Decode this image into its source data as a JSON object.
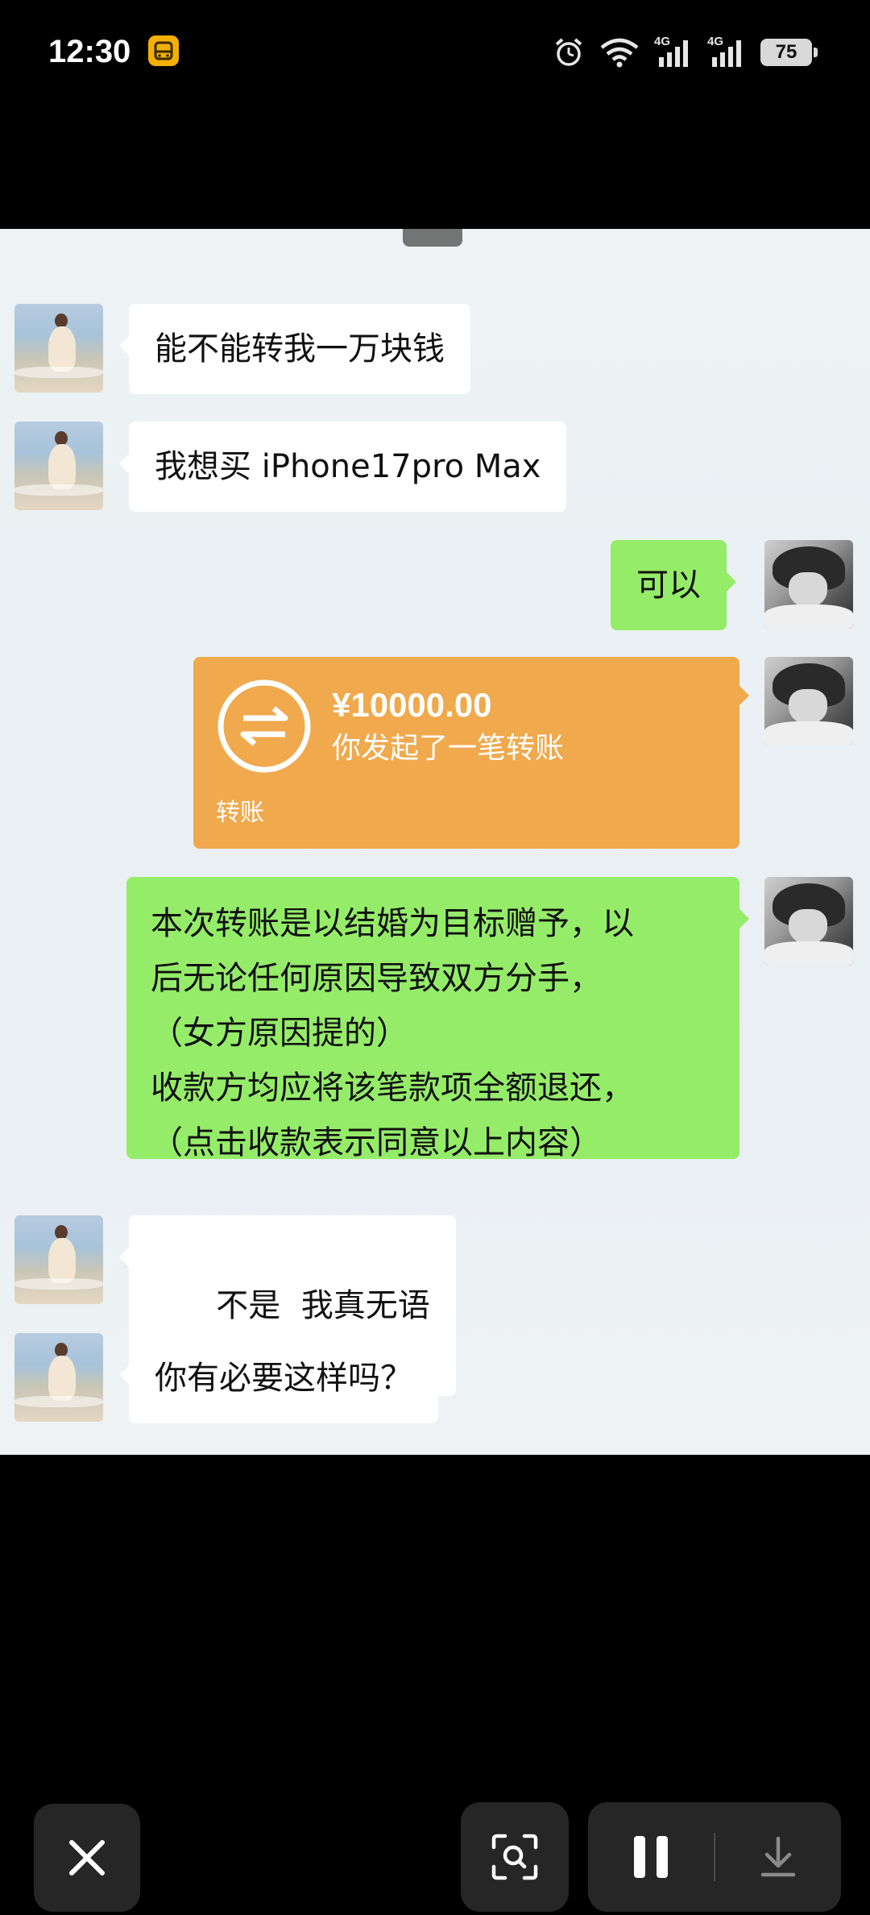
{
  "status_bar": {
    "time": "12:30",
    "battery_level": "75",
    "network_1": "4G",
    "network_2": "4G"
  },
  "chat": {
    "messages": [
      {
        "sender": "other",
        "text": "能不能转我一万块钱"
      },
      {
        "sender": "other",
        "text": "我想买 iPhone17pro Max"
      },
      {
        "sender": "self",
        "text": "可以"
      },
      {
        "sender": "self",
        "type": "transfer",
        "amount": "¥10000.00",
        "description": "你发起了一笔转账",
        "label": "转账"
      },
      {
        "sender": "self",
        "lines": [
          "本次转账是以结婚为目标赠予，以",
          "后无论任何原因导致双方分手，",
          "（女方原因提的）",
          "收款方均应将该笔款项全额退还，",
          "（点击收款表示同意以上内容）"
        ]
      },
      {
        "sender": "other",
        "text": "不是  我真无语"
      },
      {
        "sender": "other",
        "text": "你有必要这样吗？"
      }
    ]
  },
  "controls": {
    "close_icon": "close-icon",
    "scan_icon": "scan-search-icon",
    "pause_icon": "pause-icon",
    "download_icon": "download-icon"
  },
  "colors": {
    "my_bubble": "#95ec69",
    "their_bubble": "#ffffff",
    "transfer_card": "#f0a94d",
    "control_bg": "#262626"
  }
}
